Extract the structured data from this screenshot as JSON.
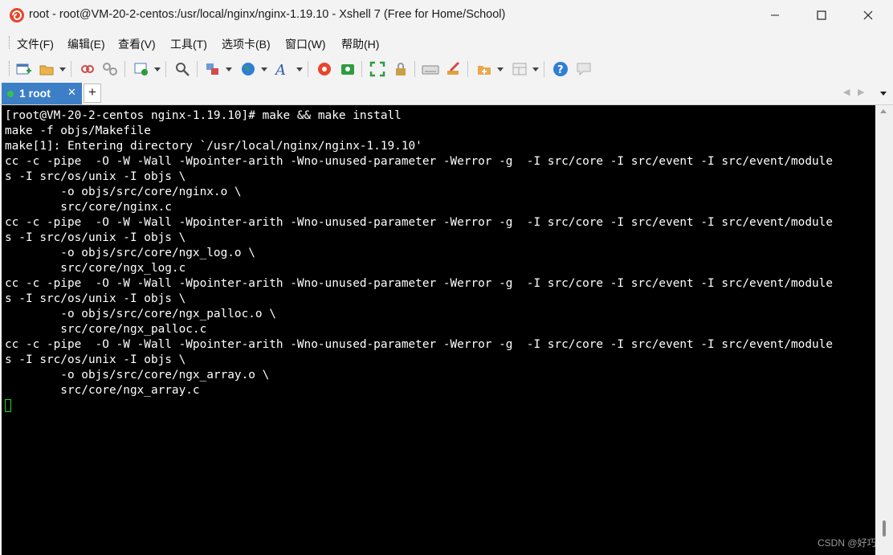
{
  "window": {
    "title": "root - root@VM-20-2-centos:/usr/local/nginx/nginx-1.19.10 - Xshell 7 (Free for Home/School)"
  },
  "menu": [
    "文件(F)",
    "编辑(E)",
    "查看(V)",
    "工具(T)",
    "选项卡(B)",
    "窗口(W)",
    "帮助(H)"
  ],
  "toolbar": {
    "icons": [
      "new-session-icon",
      "open-folder-icon",
      "reconnect-icon",
      "disconnect-icon",
      "properties-icon",
      "find-icon",
      "transfer-icon",
      "globe-icon",
      "font-icon",
      "xshell-icon",
      "xftp-icon",
      "fullscreen-icon",
      "lock-icon",
      "keyboard-icon",
      "compose-icon",
      "new-tab-icon",
      "layout-icon",
      "help-icon",
      "chat-icon"
    ]
  },
  "tab": {
    "label": "1 root",
    "close": "✕",
    "add": "+",
    "prev": "◀",
    "next": "▶"
  },
  "terminal": {
    "lines": [
      "[root@VM-20-2-centos nginx-1.19.10]# make && make install",
      "make -f objs/Makefile",
      "make[1]: Entering directory `/usr/local/nginx/nginx-1.19.10'",
      "cc -c -pipe  -O -W -Wall -Wpointer-arith -Wno-unused-parameter -Werror -g  -I src/core -I src/event -I src/event/module",
      "s -I src/os/unix -I objs \\",
      "        -o objs/src/core/nginx.o \\",
      "        src/core/nginx.c",
      "cc -c -pipe  -O -W -Wall -Wpointer-arith -Wno-unused-parameter -Werror -g  -I src/core -I src/event -I src/event/module",
      "s -I src/os/unix -I objs \\",
      "        -o objs/src/core/ngx_log.o \\",
      "        src/core/ngx_log.c",
      "cc -c -pipe  -O -W -Wall -Wpointer-arith -Wno-unused-parameter -Werror -g  -I src/core -I src/event -I src/event/module",
      "s -I src/os/unix -I objs \\",
      "        -o objs/src/core/ngx_palloc.o \\",
      "        src/core/ngx_palloc.c",
      "cc -c -pipe  -O -W -Wall -Wpointer-arith -Wno-unused-parameter -Werror -g  -I src/core -I src/event -I src/event/module",
      "s -I src/os/unix -I objs \\",
      "        -o objs/src/core/ngx_array.o \\",
      "        src/core/ngx_array.c"
    ],
    "cursor_color": "#23d823",
    "background": "#000000",
    "foreground": "#ffffff"
  },
  "watermark": "CSDN @好巧."
}
